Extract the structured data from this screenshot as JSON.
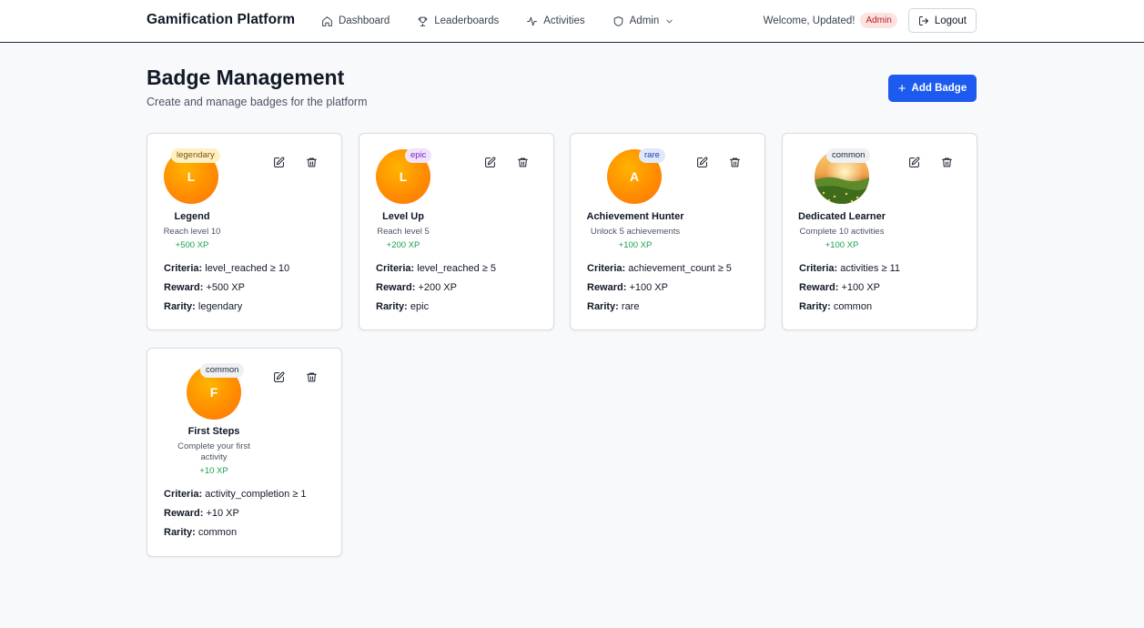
{
  "header": {
    "brand": "Gamification Platform",
    "nav": [
      {
        "label": "Dashboard",
        "icon": "home-icon"
      },
      {
        "label": "Leaderboards",
        "icon": "trophy-icon"
      },
      {
        "label": "Activities",
        "icon": "activity-icon"
      },
      {
        "label": "Admin",
        "icon": "shield-icon"
      }
    ],
    "welcome": "Welcome, Updated!",
    "role_badge": "Admin",
    "logout_label": "Logout"
  },
  "page": {
    "title": "Badge Management",
    "subtitle": "Create and manage badges for the platform",
    "add_button_label": "Add Badge"
  },
  "labels": {
    "criteria": "Criteria:",
    "reward": "Reward:",
    "rarity": "Rarity:"
  },
  "badges": [
    {
      "name": "Legend",
      "letter": "L",
      "rarity": "legendary",
      "description": "Reach level 10",
      "xp": "+500 XP",
      "criteria": "level_reached ≥ 10",
      "reward": "+500 XP"
    },
    {
      "name": "Level Up",
      "letter": "L",
      "rarity": "epic",
      "description": "Reach level 5",
      "xp": "+200 XP",
      "criteria": "level_reached ≥ 5",
      "reward": "+200 XP"
    },
    {
      "name": "Achievement Hunter",
      "letter": "A",
      "rarity": "rare",
      "description": "Unlock 5 achievements",
      "xp": "+100 XP",
      "criteria": "achievement_count ≥ 5",
      "reward": "+100 XP"
    },
    {
      "name": "Dedicated Learner",
      "letter": "",
      "rarity": "common",
      "description": "Complete 10 activities",
      "xp": "+100 XP",
      "criteria": "activities ≥ 11",
      "reward": "+100 XP"
    },
    {
      "name": "First Steps",
      "letter": "F",
      "rarity": "common",
      "description": "Complete your first activity",
      "xp": "+10 XP",
      "criteria": "activity_completion ≥ 1",
      "reward": "+10 XP"
    }
  ],
  "colors": {
    "primary": "#1d5bf0",
    "xp_green": "#16a34a",
    "admin_badge_bg": "#fde2e2"
  }
}
